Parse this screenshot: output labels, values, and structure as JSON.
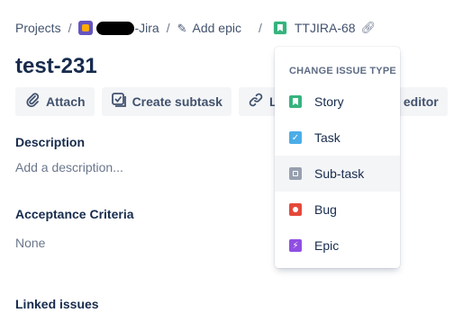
{
  "breadcrumb": {
    "projects": "Projects",
    "separator": "/",
    "project_name_suffix": "-Jira",
    "add_epic": "Add epic",
    "issue_key": "TTJIRA-68"
  },
  "issue": {
    "title": "test-231"
  },
  "toolbar": {
    "attach": "Attach",
    "create_subtask": "Create subtask",
    "link": "Link",
    "html_editor_partial": "ML editor"
  },
  "fields": {
    "description_label": "Description",
    "description_placeholder": "Add a description...",
    "acceptance_label": "Acceptance Criteria",
    "acceptance_value": "None",
    "linked_issues_label": "Linked issues"
  },
  "dropdown": {
    "header": "CHANGE ISSUE TYPE",
    "items": [
      {
        "label": "Story",
        "icon": "story-icon",
        "color": "#36b37e"
      },
      {
        "label": "Task",
        "icon": "task-icon",
        "color": "#4bade8"
      },
      {
        "label": "Sub-task",
        "icon": "subtask-icon",
        "color": "#97a0af"
      },
      {
        "label": "Bug",
        "icon": "bug-icon",
        "color": "#e5493a"
      },
      {
        "label": "Epic",
        "icon": "epic-icon",
        "color": "#904ee2"
      }
    ],
    "hovered": "Sub-task"
  }
}
